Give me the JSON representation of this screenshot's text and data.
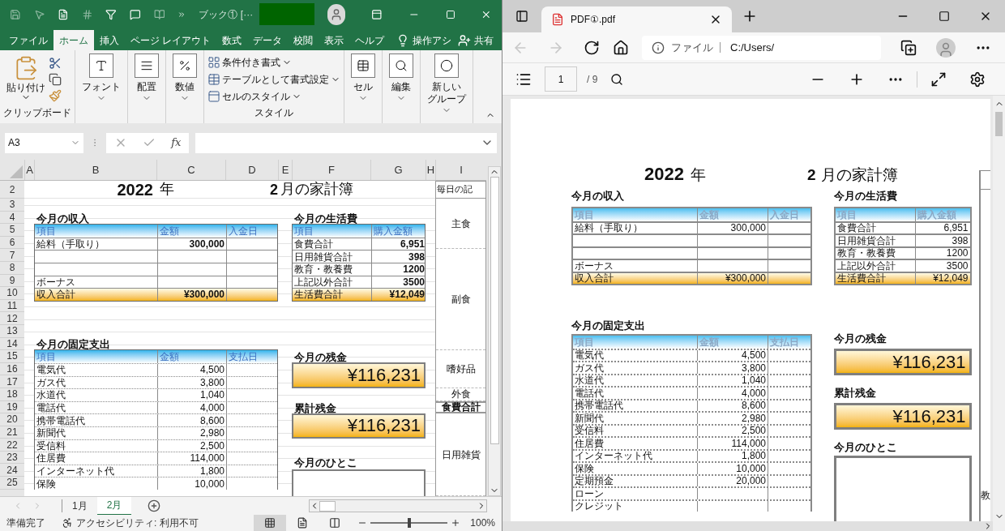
{
  "excel": {
    "window": {
      "title": "ブック①  [···"
    },
    "menu_tabs": [
      {
        "label": "ファイル",
        "selected": false
      },
      {
        "label": "ホーム",
        "selected": true
      },
      {
        "label": "挿入",
        "selected": false
      },
      {
        "label": "ページ レイアウト",
        "selected": false
      },
      {
        "label": "数式",
        "selected": false
      },
      {
        "label": "データ",
        "selected": false
      },
      {
        "label": "校閲",
        "selected": false
      },
      {
        "label": "表示",
        "selected": false
      },
      {
        "label": "ヘルプ",
        "selected": false
      }
    ],
    "tell_me": "操作アシ",
    "share": "共有",
    "ribbon": [
      {
        "kind": "clipboard",
        "label": "貼り付け",
        "footer": "クリップボード"
      },
      {
        "kind": "font",
        "label": "フォント"
      },
      {
        "kind": "alignment",
        "label": "配置"
      },
      {
        "kind": "number",
        "label": "数値"
      },
      {
        "kind": "styles",
        "items": [
          "条件付き書式",
          "テーブルとして書式設定",
          "セルのスタイル"
        ],
        "footer": "スタイル"
      },
      {
        "kind": "cells",
        "label": "セル"
      },
      {
        "kind": "editing",
        "label": "編集"
      },
      {
        "kind": "newgroup",
        "label": "新しい",
        "label_2": "グループ"
      }
    ],
    "name_box": "A3",
    "function_label": "fx",
    "columns": [
      "A",
      "B",
      "C",
      "D",
      "E",
      "F",
      "G",
      "H",
      "I"
    ],
    "rows": [
      "2",
      "3",
      "4",
      "5",
      "6",
      "7",
      "8",
      "9",
      "10",
      "11",
      "12",
      "13",
      "14",
      "15",
      "16",
      "17",
      "18",
      "19",
      "20",
      "21",
      "22",
      "23",
      "24",
      "25"
    ],
    "title": {
      "year": "2022",
      "year_unit": "年",
      "month": "2",
      "month_unit": "月の家計簿",
      "daily": "毎日の記"
    },
    "income": {
      "heading": "今月の収入",
      "columns": [
        "項目",
        "金額",
        "入金日"
      ],
      "rows": [
        {
          "item": "給料（手取り）",
          "amount": "300,000"
        },
        {},
        {},
        {
          "item": "ボーナス"
        }
      ],
      "total": {
        "item": "収入合計",
        "amount": "¥300,000"
      }
    },
    "living": {
      "heading": "今月の生活費",
      "columns": [
        "項目",
        "購入金額"
      ],
      "rows": [
        {
          "item": "食費合計",
          "amount": "6,951"
        },
        {
          "item": "日用雑貨合計",
          "amount": "398"
        },
        {
          "item": "教育・教養費",
          "amount": "1200"
        },
        {
          "item": "上記以外合計",
          "amount": "3500"
        }
      ],
      "total": {
        "item": "生活費合計",
        "amount": "¥12,049"
      }
    },
    "fixed": {
      "heading": "今月の固定支出",
      "columns": [
        "項目",
        "金額",
        "支払日"
      ],
      "rows": [
        {
          "item": "電気代",
          "amount": "4,500"
        },
        {
          "item": "ガス代",
          "amount": "3,800"
        },
        {
          "item": "水道代",
          "amount": "1,040"
        },
        {
          "item": "電話代",
          "amount": "4,000"
        },
        {
          "item": "携帯電話代",
          "amount": "8,600"
        },
        {
          "item": "新聞代",
          "amount": "2,980"
        },
        {
          "item": "受信料",
          "amount": "2,500"
        },
        {
          "item": "住居費",
          "amount": "114,000"
        },
        {
          "item": "インターネット代",
          "amount": "1,800"
        },
        {
          "item": "保険",
          "amount": "10,000"
        }
      ]
    },
    "balance": {
      "heading": "今月の残金",
      "value": "¥116,231"
    },
    "cumulative": {
      "heading": "累計残金",
      "value": "¥116,231"
    },
    "comment": {
      "heading": "今月のひとこ"
    },
    "daily_sections": [
      {
        "label": "主食",
        "kind": "category"
      },
      {
        "label": "副食",
        "kind": "category"
      },
      {
        "label": "嗜好品",
        "kind": "category"
      },
      {
        "label": "外食",
        "kind": "category"
      },
      {
        "label": "食費合計",
        "kind": "total"
      },
      {
        "label": "日用雑貨",
        "kind": "category"
      }
    ],
    "sheet_tabs": [
      {
        "label": "1月",
        "selected": false
      },
      {
        "label": "2月",
        "selected": true
      }
    ],
    "status": {
      "ready": "準備完了",
      "accessibility": "アクセシビリティ: 利用不可",
      "views": [
        {
          "kind": "normal",
          "selected": true
        },
        {
          "kind": "page_layout",
          "selected": false
        },
        {
          "kind": "page_break",
          "selected": false
        }
      ],
      "zoom_slider": {
        "level": 0.5
      },
      "zoom": "100%"
    }
  },
  "pdf": {
    "tab": {
      "title": "PDF①.pdf"
    },
    "back": {
      "disabled": true
    },
    "forward": {
      "disabled": true
    },
    "address": {
      "label": "ファイル",
      "url": "C:/Users/"
    },
    "page": {
      "current": "1",
      "total": "/ 9"
    },
    "title": {
      "year": "2022",
      "year_unit": "年",
      "month": "2",
      "month_unit": "月の家計簿"
    },
    "income": {
      "heading": "今月の収入",
      "columns": [
        "項目",
        "金額",
        "入金日"
      ],
      "rows": [
        {
          "item": "給料（手取り）",
          "amount": "300,000"
        },
        {},
        {},
        {
          "item": "ボーナス"
        }
      ],
      "total": {
        "item": "収入合計",
        "amount": "¥300,000"
      }
    },
    "living": {
      "heading": "今月の生活費",
      "columns": [
        "項目",
        "購入金額"
      ],
      "rows": [
        {
          "item": "食費合計",
          "amount": "6,951"
        },
        {
          "item": "日用雑貨合計",
          "amount": "398"
        },
        {
          "item": "教育・教養費",
          "amount": "1200"
        },
        {
          "item": "上記以外合計",
          "amount": "3500"
        }
      ],
      "total": {
        "item": "生活費合計",
        "amount": "¥12,049"
      }
    },
    "fixed": {
      "heading": "今月の固定支出",
      "columns": [
        "項目",
        "金額",
        "支払日"
      ],
      "rows": [
        {
          "item": "電気代",
          "amount": "4,500"
        },
        {
          "item": "ガス代",
          "amount": "3,800"
        },
        {
          "item": "水道代",
          "amount": "1,040"
        },
        {
          "item": "電話代",
          "amount": "4,000"
        },
        {
          "item": "携帯電話代",
          "amount": "8,600"
        },
        {
          "item": "新聞代",
          "amount": "2,980"
        },
        {
          "item": "受信料",
          "amount": "2,500"
        },
        {
          "item": "住居費",
          "amount": "114,000"
        },
        {
          "item": "インターネット代",
          "amount": "1,800"
        },
        {
          "item": "保険",
          "amount": "10,000"
        },
        {
          "item": "定期預金",
          "amount": "20,000"
        },
        {
          "item": "ローン"
        },
        {
          "item": "クレジット"
        }
      ]
    },
    "balance": {
      "heading": "今月の残金",
      "value": "¥116,231"
    },
    "cumulative": {
      "heading": "累計残金",
      "value": "¥116,231"
    },
    "comment": {
      "heading": "今月のひとこ"
    },
    "edge_fragment": "教"
  }
}
